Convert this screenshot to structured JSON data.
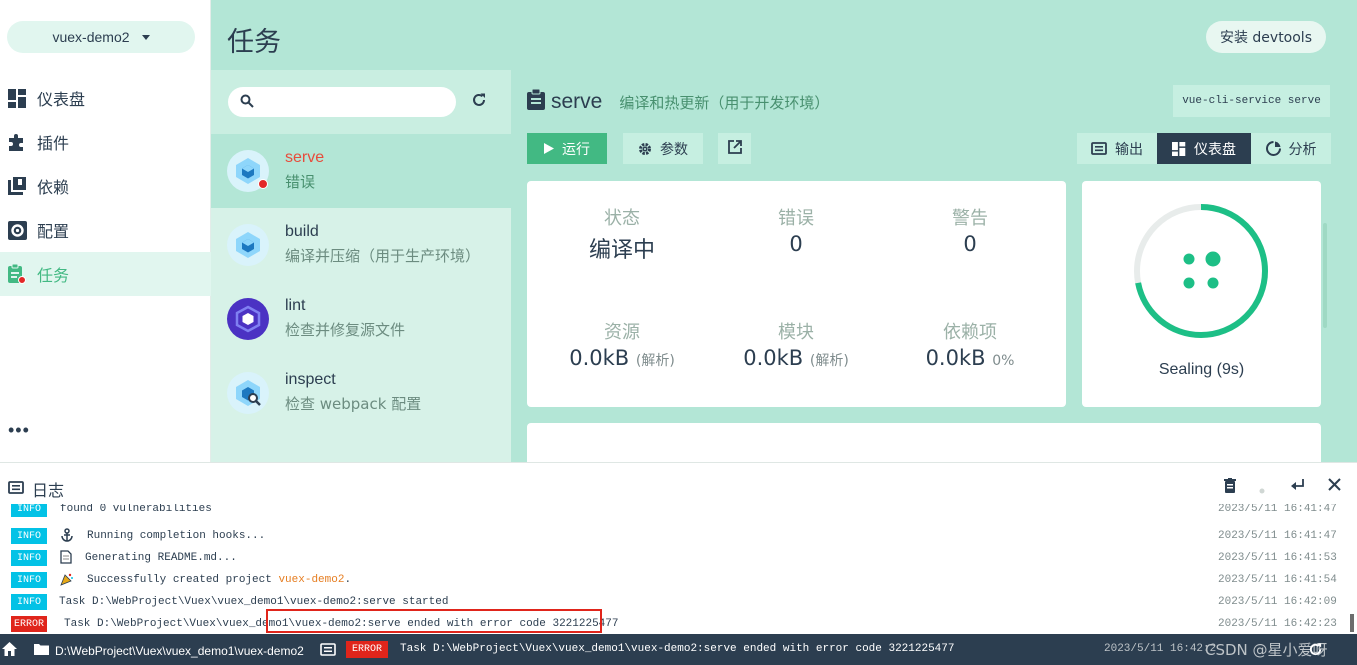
{
  "sidebar": {
    "project": "vuex-demo2",
    "items": [
      {
        "label": "仪表盘",
        "icon": "dashboard-icon"
      },
      {
        "label": "插件",
        "icon": "puzzle-icon"
      },
      {
        "label": "依赖",
        "icon": "library-icon"
      },
      {
        "label": "配置",
        "icon": "settings-icon"
      },
      {
        "label": "任务",
        "icon": "tasks-icon"
      }
    ],
    "more": "•••"
  },
  "header": {
    "title": "任务",
    "devtools_label": "安装 devtools"
  },
  "tasks": [
    {
      "name": "serve",
      "desc": "错误",
      "status": "error"
    },
    {
      "name": "build",
      "desc": "编译并压缩（用于生产环境）"
    },
    {
      "name": "lint",
      "desc": "检查并修复源文件"
    },
    {
      "name": "inspect",
      "desc": "检查 webpack 配置"
    }
  ],
  "detail": {
    "title": "serve",
    "description": "编译和热更新（用于开发环境）",
    "command": "vue-cli-service serve",
    "buttons": {
      "run": "运行",
      "params": "参数",
      "output": "输出",
      "dashboard": "仪表盘",
      "analyze": "分析"
    },
    "stats": {
      "status_label": "状态",
      "status_value": "编译中",
      "errors_label": "错误",
      "errors_value": "0",
      "warnings_label": "警告",
      "warnings_value": "0",
      "assets_label": "资源",
      "assets_value": "0.0kB",
      "assets_unit": "(解析)",
      "modules_label": "模块",
      "modules_value": "0.0kB",
      "modules_unit": "(解析)",
      "deps_label": "依赖项",
      "deps_value": "0.0kB",
      "deps_unit": "0%"
    },
    "progress": {
      "label": "Sealing (9s)",
      "fraction": 0.72
    }
  },
  "log": {
    "title": "日志",
    "lines": [
      {
        "tag": "INFO",
        "icon": "",
        "msg": "found 0 vulnerabilities",
        "time": "2023/5/11  16:41:47"
      },
      {
        "tag": "INFO",
        "icon": "anchor-icon",
        "msg": "Running completion hooks...",
        "time": "2023/5/11  16:41:47"
      },
      {
        "tag": "INFO",
        "icon": "document-icon",
        "msg": "Generating README.md...",
        "time": "2023/5/11  16:41:53"
      },
      {
        "tag": "INFO",
        "icon": "party-icon",
        "msg_pre": "Successfully created project ",
        "msg_hl": "vuex-demo2",
        "msg_post": ".",
        "time": "2023/5/11  16:41:54"
      },
      {
        "tag": "INFO",
        "icon": "",
        "msg": "Task D:\\WebProject\\Vuex\\vuex_demo1\\vuex-demo2:serve started",
        "time": "2023/5/11  16:42:09"
      },
      {
        "tag": "ERROR",
        "icon": "",
        "msg": "Task D:\\WebProject\\Vuex\\vuex_demo1\\vuex-demo2:serve ended with error code 3221225477",
        "time": "2023/5/11  16:42:23"
      }
    ]
  },
  "statusbar": {
    "path": "D:\\WebProject\\Vuex\\vuex_demo1\\vuex-demo2",
    "tag": "ERROR",
    "message": "Task D:\\WebProject\\Vuex\\vuex_demo1\\vuex-demo2:serve ended with error code 3221225477",
    "time": "2023/5/11  16:42:2",
    "watermark": "CSDN @星小爱呀"
  },
  "colors": {
    "accent": "#42b983",
    "mint": "#b3e6d6",
    "dark": "#2c3e50",
    "error": "#e0251b",
    "info": "#03c2e6"
  }
}
